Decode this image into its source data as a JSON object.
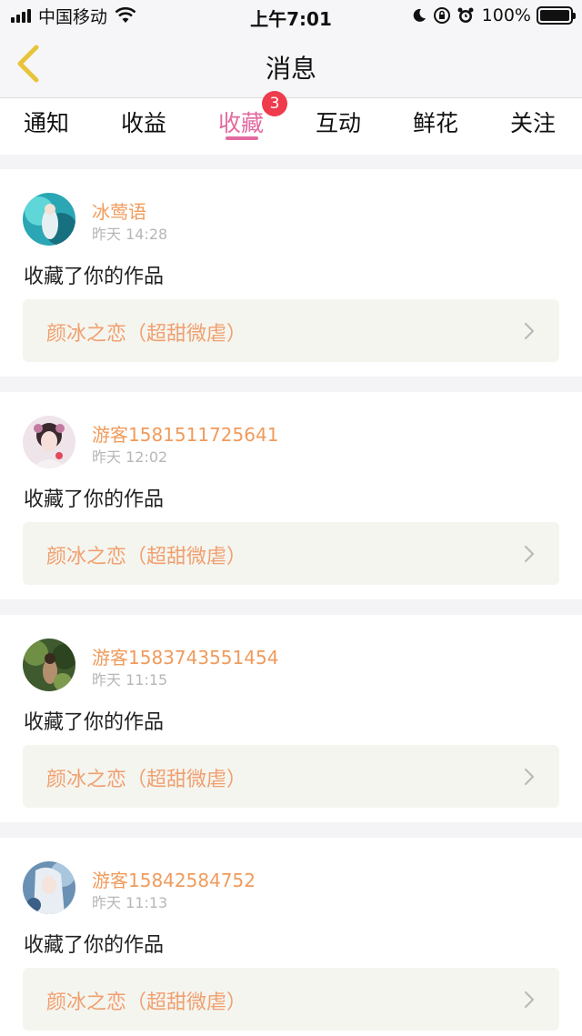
{
  "status_bar": {
    "carrier": "中国移动",
    "time": "上午7:01",
    "battery": "100%"
  },
  "nav": {
    "title": "消息"
  },
  "tabs": [
    {
      "label": "通知"
    },
    {
      "label": "收益"
    },
    {
      "label": "收藏",
      "active": true,
      "badge": "3"
    },
    {
      "label": "互动"
    },
    {
      "label": "鲜花"
    },
    {
      "label": "关注"
    }
  ],
  "messages": [
    {
      "user": "冰莺语",
      "time": "昨天 14:28",
      "action": "收藏了你的作品",
      "work": "颜冰之恋（超甜微虐）"
    },
    {
      "user": "游客1581511725641",
      "time": "昨天 12:02",
      "action": "收藏了你的作品",
      "work": "颜冰之恋（超甜微虐）"
    },
    {
      "user": "游客1583743551454",
      "time": "昨天 11:15",
      "action": "收藏了你的作品",
      "work": "颜冰之恋（超甜微虐）"
    },
    {
      "user": "游客15842584752",
      "time": "昨天 11:13",
      "action": "收藏了你的作品",
      "work": "颜冰之恋（超甜微虐）"
    }
  ],
  "colors": {
    "accent": "#e26aa0",
    "username": "#f09b5c",
    "work_title": "#f0a070",
    "badge": "#ef3b4c",
    "back_arrow": "#e8c43a"
  }
}
